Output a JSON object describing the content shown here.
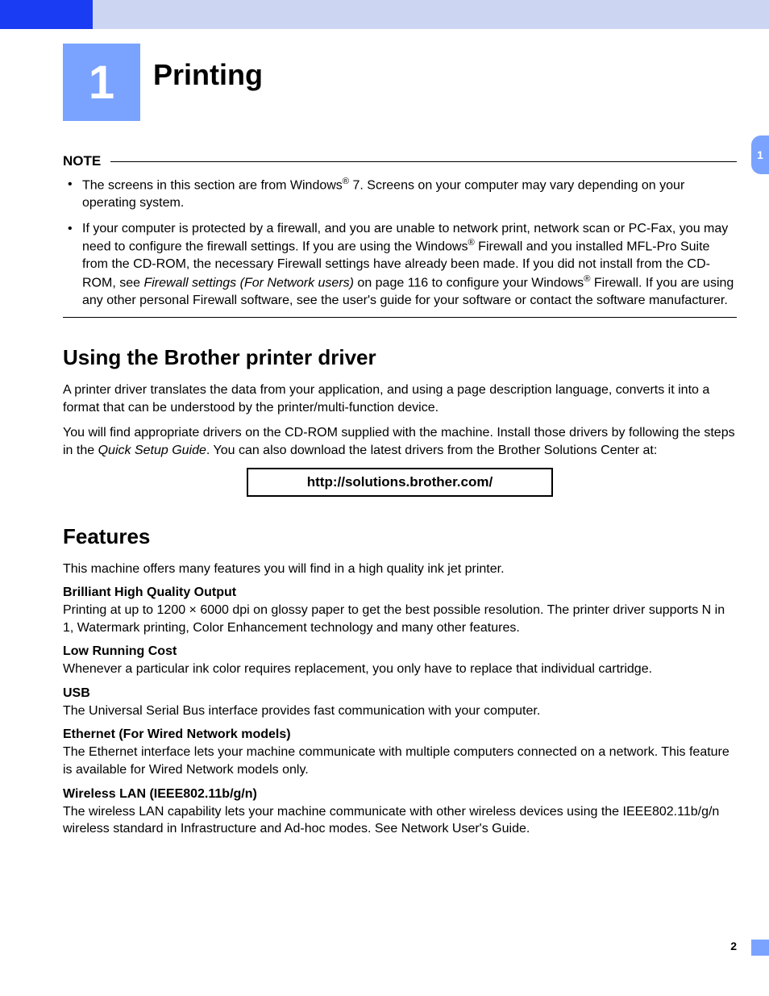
{
  "chapter": {
    "number": "1",
    "title": "Printing"
  },
  "side_tab": "1",
  "note": {
    "label": "NOTE",
    "items": [
      {
        "pre": "The screens in this section are from Windows",
        "sup": "®",
        "post": " 7. Screens on your computer may vary depending on your operating system."
      },
      {
        "p1a": "If your computer is protected by a firewall, and you are unable to network print, network scan or PC-Fax, you may need to configure the firewall settings. If you are using the Windows",
        "p1sup": "®",
        "p1b": " Firewall and you installed MFL-Pro Suite from the CD-ROM, the necessary Firewall settings have already been made. If you did not install from the CD-ROM, see ",
        "p1i": "Firewall settings (For Network users)",
        "p1c": " on page 116 to configure your Windows",
        "p1sup2": "®",
        "p1d": " Firewall. If you are using any other personal Firewall software, see the user's guide for your software or contact the software manufacturer."
      }
    ]
  },
  "section1": {
    "heading": "Using the Brother printer driver",
    "p1": "A printer driver translates the data from your application, and using a page description language, converts it into a format that can be understood by the printer/multi-function device.",
    "p2a": "You will find appropriate drivers on the CD-ROM supplied with the machine. Install those drivers by following the steps in the ",
    "p2i": "Quick Setup Guide",
    "p2b": ". You can also download the latest drivers from the Brother Solutions Center at:",
    "link": "http://solutions.brother.com/"
  },
  "section2": {
    "heading": "Features",
    "intro": "This machine offers many features you will find in a high quality ink jet printer.",
    "items": [
      {
        "title": "Brilliant High Quality Output",
        "desc": "Printing at up to 1200 × 6000 dpi on glossy paper to get the best possible resolution. The printer driver supports N in 1, Watermark printing, Color Enhancement technology and many other features."
      },
      {
        "title": "Low Running Cost",
        "desc": "Whenever a particular ink color requires replacement, you only have to replace that individual cartridge."
      },
      {
        "title": "USB",
        "desc": "The Universal Serial Bus interface provides fast communication with your computer."
      },
      {
        "title": "Ethernet (For Wired Network models)",
        "desc": "The Ethernet interface lets your machine communicate with multiple computers connected on a network. This feature is available for Wired Network models only."
      },
      {
        "title": "Wireless LAN (IEEE802.11b/g/n)",
        "desc": "The wireless LAN capability lets your machine communicate with other wireless devices using the IEEE802.11b/g/n wireless standard in Infrastructure and Ad-hoc modes. See Network User's Guide."
      }
    ]
  },
  "page_number": "2"
}
